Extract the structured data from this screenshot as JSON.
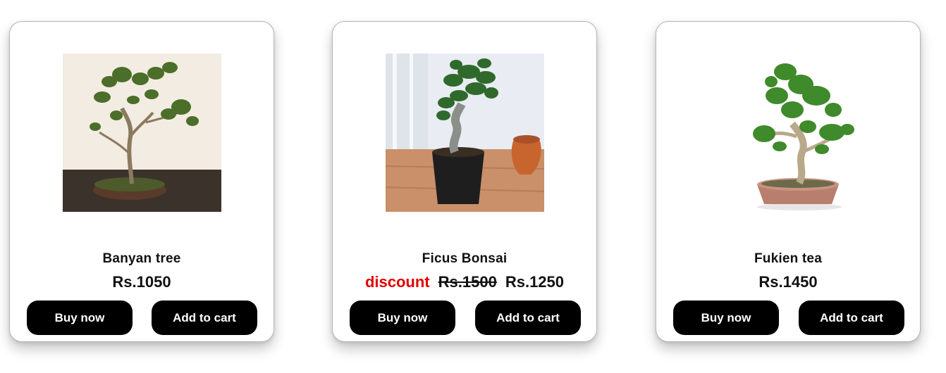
{
  "products": [
    {
      "image_name": "banyan-bonsai-photo",
      "title": "Banyan tree",
      "price": "Rs.1050",
      "buy_label": "Buy now",
      "cart_label": "Add to cart"
    },
    {
      "image_name": "ficus-bonsai-photo",
      "title": "Ficus Bonsai",
      "discount_label": "discount",
      "old_price": "Rs.1500",
      "price": "Rs.1250",
      "buy_label": "Buy now",
      "cart_label": "Add to cart"
    },
    {
      "image_name": "fukien-tea-bonsai-photo",
      "title": "Fukien tea",
      "price": "Rs.1450",
      "buy_label": "Buy now",
      "cart_label": "Add to cart"
    }
  ],
  "colors": {
    "button_bg": "#000000",
    "button_text": "#ffffff",
    "discount": "#e00000",
    "card_border": "#b5b5b5"
  }
}
